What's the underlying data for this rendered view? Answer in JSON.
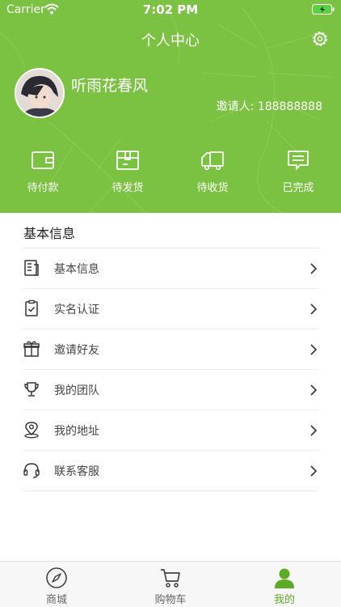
{
  "status_bar": {
    "carrier": "Carrier",
    "time": "7:02 PM"
  },
  "header": {
    "title": "个人中心",
    "username": "听雨花春风",
    "inviter": "邀请人: 188888888"
  },
  "orders": [
    {
      "label": "待付款",
      "icon": "wallet-icon"
    },
    {
      "label": "待发货",
      "icon": "box-icon"
    },
    {
      "label": "待收货",
      "icon": "truck-icon"
    },
    {
      "label": "已完成",
      "icon": "message-icon"
    }
  ],
  "section": {
    "title": "基本信息"
  },
  "menu": [
    {
      "label": "基本信息",
      "icon": "document-icon"
    },
    {
      "label": "实名认证",
      "icon": "clipboard-check-icon"
    },
    {
      "label": "邀请好友",
      "icon": "gift-icon"
    },
    {
      "label": "我的团队",
      "icon": "trophy-icon"
    },
    {
      "label": "我的地址",
      "icon": "location-icon"
    },
    {
      "label": "联系客服",
      "icon": "headset-icon"
    }
  ],
  "tabs": [
    {
      "label": "商城",
      "icon": "compass-icon",
      "active": false
    },
    {
      "label": "购物车",
      "icon": "cart-icon",
      "active": false
    },
    {
      "label": "我的",
      "icon": "user-icon",
      "active": true
    }
  ],
  "colors": {
    "brand_green": "#7cc242",
    "active_tab": "#5faa24",
    "battery": "#55d341"
  }
}
